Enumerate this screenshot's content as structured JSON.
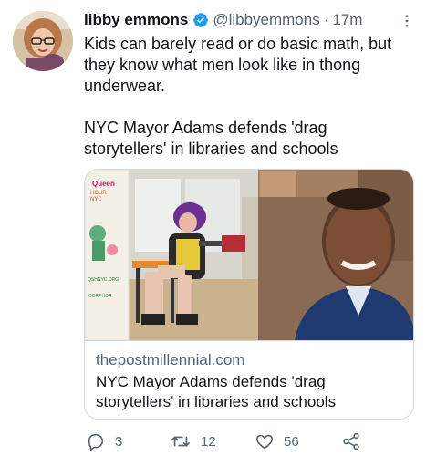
{
  "tweet": {
    "author": {
      "display_name": "libby emmons",
      "handle": "@libbyemmons",
      "verified": true
    },
    "separator": "·",
    "time": "17m",
    "text_lines": [
      "Kids can barely read or do basic math, but",
      "they know  what men look like in thong",
      "underwear."
    ],
    "text_lines_2": [
      "NYC Mayor Adams defends 'drag",
      "storytellers' in libraries and schools"
    ]
  },
  "card": {
    "domain": "thepostmillennial.com",
    "title_lines": [
      "NYC Mayor Adams defends 'drag",
      "storytellers' in libraries and schools"
    ],
    "image_banner_text": [
      "Queen",
      "HOUR",
      "NYC",
      "QSHNYC.ORG",
      "ODRPHOR"
    ]
  },
  "actions": {
    "reply_count": "3",
    "retweet_count": "12",
    "like_count": "56"
  },
  "colors": {
    "verified_blue": "#1d9bf0",
    "secondary_text": "#536471",
    "border": "#cfd9de"
  },
  "icons": [
    "verified-badge-icon",
    "more-icon",
    "reply-icon",
    "retweet-icon",
    "like-icon",
    "share-icon"
  ]
}
